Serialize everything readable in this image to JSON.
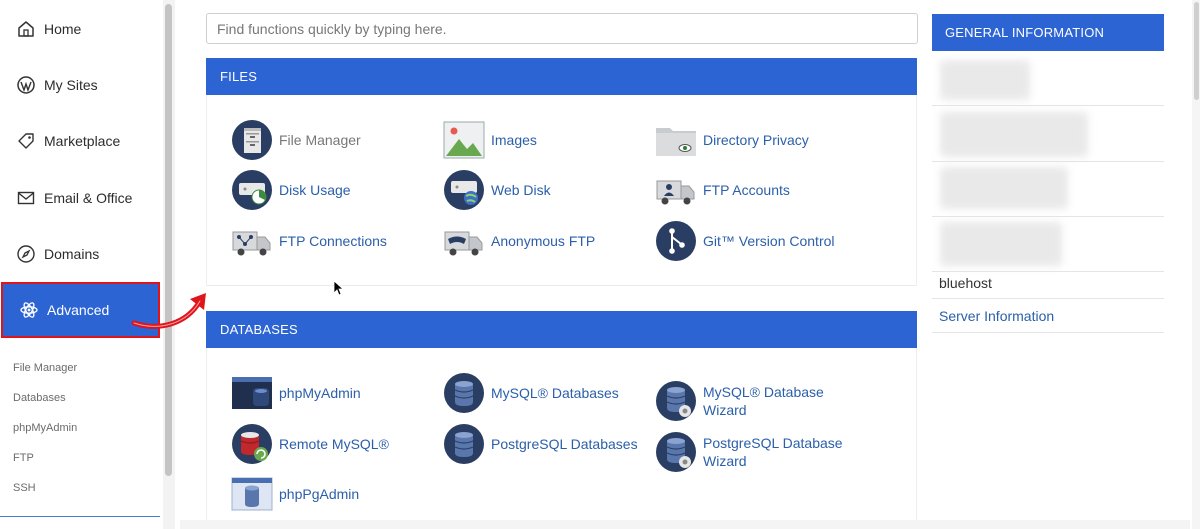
{
  "sidebar": {
    "nav": [
      {
        "label": "Home",
        "icon": "home-icon"
      },
      {
        "label": "My Sites",
        "icon": "wordpress-icon"
      },
      {
        "label": "Marketplace",
        "icon": "tag-icon"
      },
      {
        "label": "Email & Office",
        "icon": "envelope-icon"
      },
      {
        "label": "Domains",
        "icon": "compass-icon"
      },
      {
        "label": "Advanced",
        "icon": "atom-icon",
        "active": true
      }
    ],
    "sub": [
      "File Manager",
      "Databases",
      "phpMyAdmin",
      "FTP",
      "SSH"
    ]
  },
  "search": {
    "placeholder": "Find functions quickly by typing here."
  },
  "files": {
    "title": "FILES",
    "tools": [
      {
        "label": "File Manager",
        "icon": "file-cabinet-icon"
      },
      {
        "label": "Images",
        "icon": "image-icon"
      },
      {
        "label": "Directory Privacy",
        "icon": "folder-eye-icon"
      },
      {
        "label": "Disk Usage",
        "icon": "disk-usage-icon"
      },
      {
        "label": "Web Disk",
        "icon": "web-disk-icon"
      },
      {
        "label": "FTP Accounts",
        "icon": "ftp-truck-user-icon"
      },
      {
        "label": "FTP Connections",
        "icon": "ftp-truck-network-icon"
      },
      {
        "label": "Anonymous FTP",
        "icon": "ftp-truck-mask-icon"
      },
      {
        "label": "Git™ Version Control",
        "icon": "git-icon"
      }
    ]
  },
  "databases": {
    "title": "DATABASES",
    "tools": [
      {
        "label": "phpMyAdmin",
        "icon": "phpmyadmin-icon"
      },
      {
        "label": "MySQL® Databases",
        "icon": "database-icon"
      },
      {
        "label": "MySQL® Database",
        "label2": "Wizard",
        "icon": "database-wizard-icon"
      },
      {
        "label": "Remote MySQL®",
        "icon": "remote-database-icon"
      },
      {
        "label": "PostgreSQL Databases",
        "icon": "postgres-database-icon"
      },
      {
        "label": "PostgreSQL Database",
        "label2": "Wizard",
        "icon": "postgres-wizard-icon"
      },
      {
        "label": "phpPgAdmin",
        "icon": "phppgadmin-icon"
      }
    ]
  },
  "general_info": {
    "title": "GENERAL INFORMATION",
    "host": "bluehost",
    "server_link": "Server Information"
  },
  "colors": {
    "accent": "#2d64d4",
    "highlight": "#e0141b",
    "link": "#2b5faa"
  }
}
